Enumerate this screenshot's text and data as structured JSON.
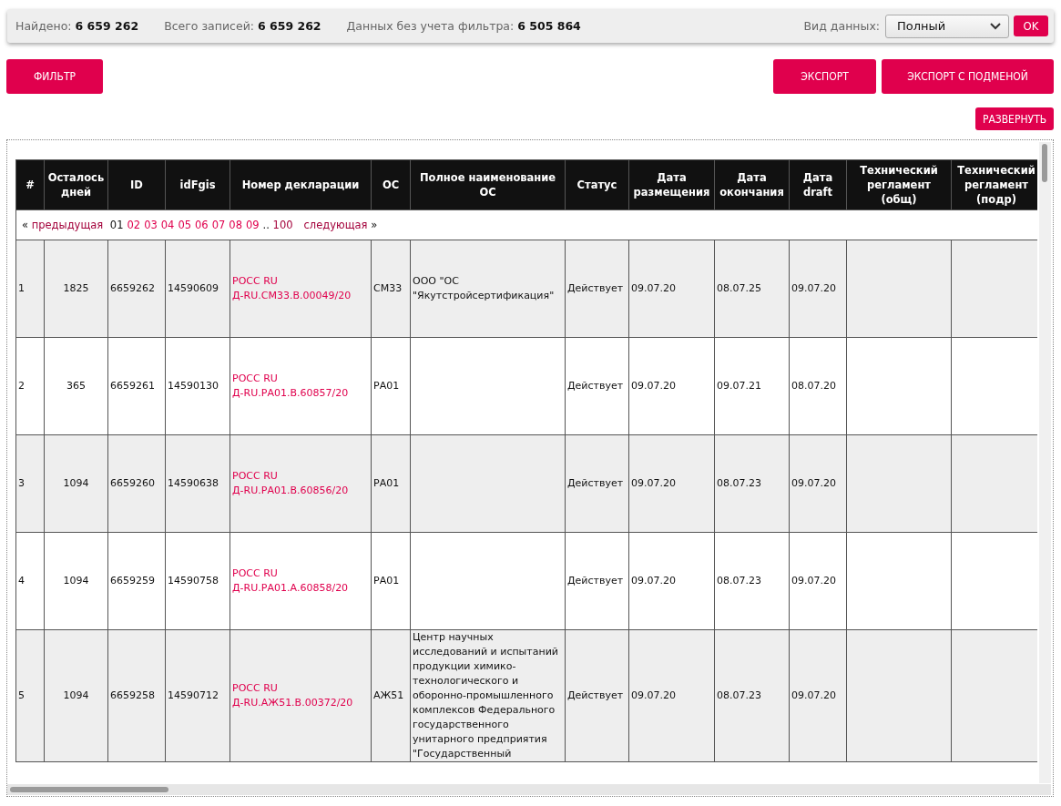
{
  "summary": {
    "items": [
      {
        "label": "Найдено:",
        "value": "6 659 262"
      },
      {
        "label": "Всего записей:",
        "value": "6 659 262"
      },
      {
        "label": "Данных без учета фильтра:",
        "value": "6 505 864"
      }
    ],
    "view_label": "Вид данных:",
    "view_select": {
      "value": "Полный"
    },
    "ok_button": "OK"
  },
  "actions": {
    "filter_button": "ФИЛЬТР",
    "export_button": "ЭКСПОРТ",
    "export_replace_button": "ЭКСПОРТ С ПОДМЕНОЙ",
    "expand_button": "РАЗВЕРНУТЬ"
  },
  "table": {
    "columns": [
      "#",
      "Осталось дней",
      "ID",
      "idFgis",
      "Номер декларации",
      "ОС",
      "Полное наименование ОС",
      "Статус",
      "Дата размещения",
      "Дата окончания",
      "Дата draft",
      "Технический регламент (общ)",
      "Технический регламент (подр)"
    ],
    "pagination": {
      "prev_arrow": "«",
      "prev": "предыдущая",
      "pages": [
        {
          "label": "01",
          "selected": true
        },
        {
          "label": "02",
          "selected": false
        },
        {
          "label": "03",
          "selected": false
        },
        {
          "label": "04",
          "selected": false
        },
        {
          "label": "05",
          "selected": false
        },
        {
          "label": "06",
          "selected": false
        },
        {
          "label": "07",
          "selected": false
        },
        {
          "label": "08",
          "selected": false
        },
        {
          "label": "09",
          "selected": false
        }
      ],
      "ellipsis": "..",
      "last": "100",
      "next": "следующая",
      "next_arrow": "»"
    },
    "rows": [
      {
        "number": "1",
        "days_left": "1825",
        "id": "6659262",
        "id_fgis": "14590609",
        "declaration": [
          "РОСС RU",
          "Д-RU.СМ33.В.00049/20"
        ],
        "os": "СМ33",
        "os_full_name": "ООО \"ОС \"Якутстройсертификация\"",
        "status": "Действует",
        "date_placed": "09.07.20",
        "date_end": "08.07.25",
        "date_draft": "09.07.20"
      },
      {
        "number": "2",
        "days_left": "365",
        "id": "6659261",
        "id_fgis": "14590130",
        "declaration": [
          "РОСС RU",
          "Д-RU.РА01.В.60857/20"
        ],
        "os": "РА01",
        "status": "Действует",
        "date_placed": "09.07.20",
        "date_end": "09.07.21",
        "date_draft": "08.07.20"
      },
      {
        "number": "3",
        "days_left": "1094",
        "id": "6659260",
        "id_fgis": "14590638",
        "declaration": [
          "РОСС RU",
          "Д-RU.РА01.В.60856/20"
        ],
        "os": "РА01",
        "status": "Действует",
        "date_placed": "09.07.20",
        "date_end": "08.07.23",
        "date_draft": "09.07.20"
      },
      {
        "number": "4",
        "days_left": "1094",
        "id": "6659259",
        "id_fgis": "14590758",
        "declaration": [
          "РОСС RU",
          "Д-RU.РА01.А.60858/20"
        ],
        "os": "РА01",
        "status": "Действует",
        "date_placed": "09.07.20",
        "date_end": "08.07.23",
        "date_draft": "09.07.20"
      },
      {
        "number": "5",
        "days_left": "1094",
        "id": "6659258",
        "id_fgis": "14590712",
        "declaration": [
          "РОСС RU",
          "Д-RU.АЖ51.В.00372/20"
        ],
        "os": "АЖ51",
        "os_full_name": "Центр научных исследований и испытаний продукции химико-технологического и оборонно-промышленного комплексов Федерального государственного унитарного предприятия \"Государственный",
        "status": "Действует",
        "date_placed": "09.07.20",
        "date_end": "08.07.23",
        "date_draft": "09.07.20"
      }
    ]
  }
}
